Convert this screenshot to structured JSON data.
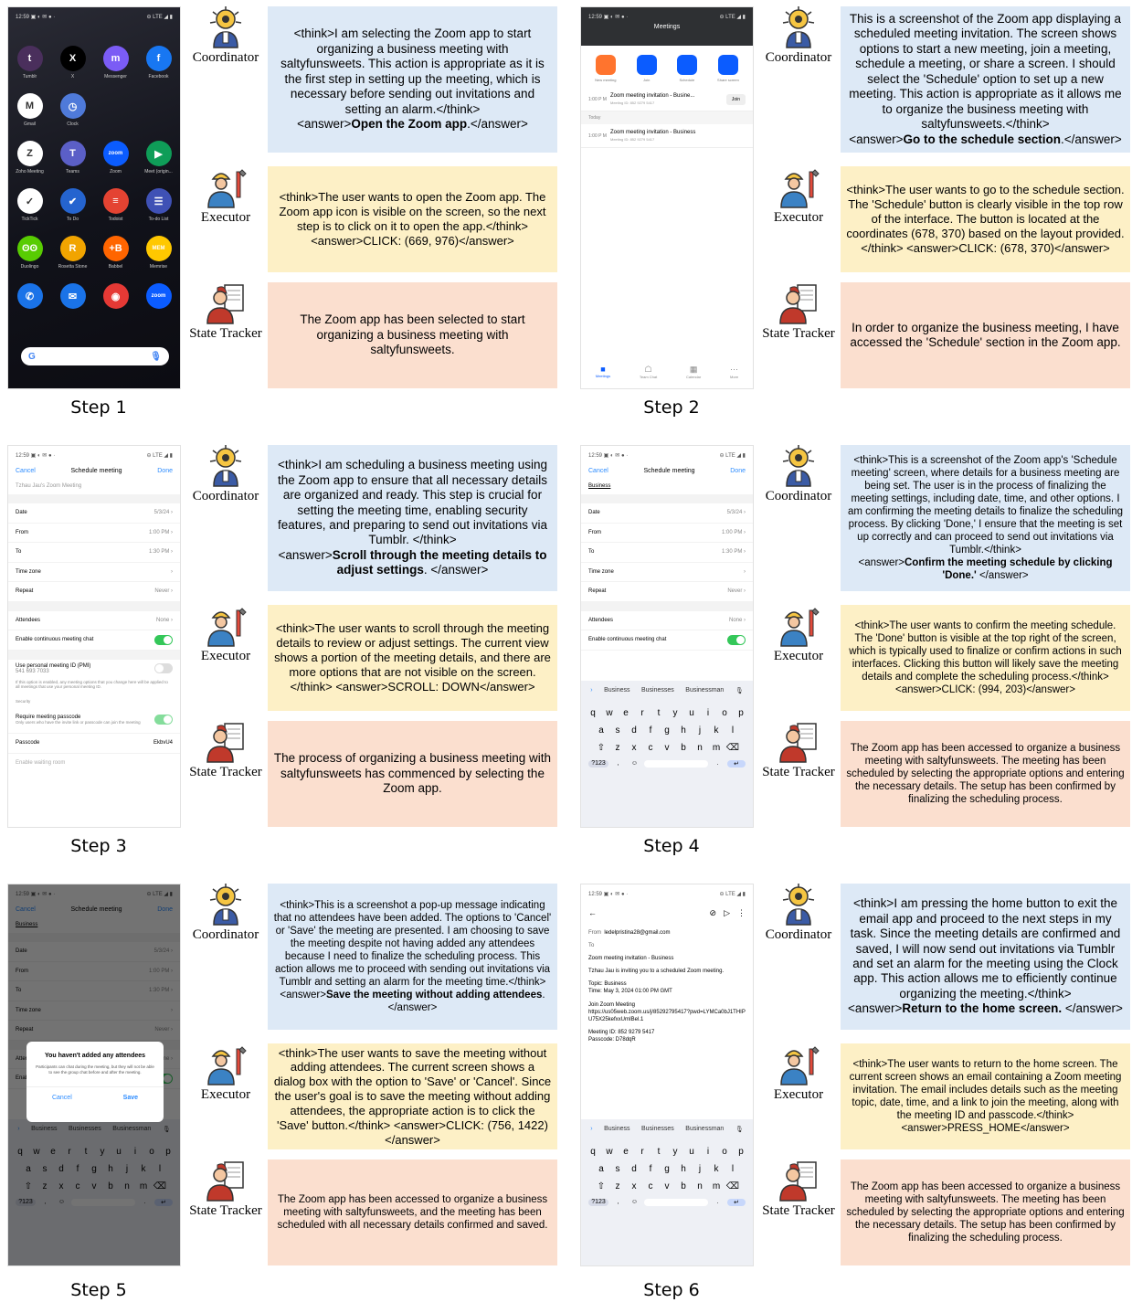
{
  "roles": {
    "coordinator": "Coordinator",
    "executor": "Executor",
    "tracker": "State Tracker"
  },
  "steps": [
    {
      "label": "Step 1",
      "coord": {
        "think": "<think>I am selecting the Zoom app to start organizing a business meeting with saltyfunsweets. This action is appropriate as it is the first step in setting up the meeting, which is necessary before sending out invitations and setting an alarm.</think>",
        "pre": "<answer>",
        "bold": "Open the Zoom app",
        "post": ".</answer>"
      },
      "exec": "<think>The user wants to open the Zoom app. The Zoom app icon is visible on the screen, so the next step is to click on it to open the app.</think> <answer>CLICK: (669, 976)</answer>",
      "tracker": "The Zoom app has been selected to start organizing a business meeting with saltyfunsweets."
    },
    {
      "label": "Step 2",
      "coord": {
        "think": "This is a screenshot of the Zoom app displaying a scheduled meeting invitation. The screen shows options to start a new meeting, join a meeting, schedule a meeting, or share a screen. I should select the 'Schedule' option to set up a new meeting. This action is appropriate as it allows me to organize the business meeting with saltyfunsweets.</think>",
        "pre": "<answer>",
        "bold": "Go to the schedule section",
        "post": ".</answer>"
      },
      "exec": "<think>The user wants to go to the schedule section. The 'Schedule' button is clearly visible in the top row of the interface. The button is located at the coordinates (678, 370) based on the layout provided.</think> <answer>CLICK: (678, 370)</answer>",
      "tracker": "In order to organize the business meeting, I have accessed the 'Schedule' section in the Zoom app."
    },
    {
      "label": "Step 3",
      "coord": {
        "think": "<think>I am scheduling a business meeting using the Zoom app to ensure that all necessary details are organized and ready. This step is crucial for setting the meeting time, enabling security features, and preparing to send out invitations via Tumblr. </think>",
        "pre": "<answer>",
        "bold": "Scroll through the meeting details to adjust settings",
        "post": ". </answer>"
      },
      "exec": "<think>The user wants to scroll through the meeting details to review or adjust settings. The current view shows a portion of the meeting details, and there are more options that are not visible on the screen.</think> <answer>SCROLL: DOWN</answer>",
      "tracker": "The process of organizing a business meeting with saltyfunsweets has commenced by selecting the Zoom app."
    },
    {
      "label": "Step 4",
      "coord": {
        "think": "<think>This is a screenshot of the Zoom app's 'Schedule meeting' screen, where details for a business meeting are being set. The user is in the process of finalizing the meeting settings, including date, time, and other options. I am confirming the meeting details to finalize the scheduling process. By clicking 'Done,' I ensure that the meeting is set up correctly and can proceed to send out invitations via Tumblr.</think>",
        "pre": "<answer>",
        "bold": "Confirm the meeting schedule by clicking 'Done.'",
        "post": " </answer>"
      },
      "exec": "<think>The user wants to confirm the meeting schedule. The 'Done' button is visible at the top right of the screen, which is typically used to finalize or confirm actions in such interfaces. Clicking this button will likely save the meeting details and complete the scheduling process.</think> <answer>CLICK: (994, 203)</answer>",
      "tracker": "The Zoom app has been accessed to organize a business meeting with saltyfunsweets. The meeting has been scheduled by selecting the appropriate options and entering the necessary details. The setup has been confirmed by finalizing the scheduling process."
    },
    {
      "label": "Step 5",
      "coord": {
        "think": "<think>This is a screenshot a pop-up message indicating that no attendees have been added. The options to 'Cancel' or 'Save' the meeting are presented. I am choosing to save the meeting despite not having added any attendees because I need to finalize the scheduling process. This action allows me to proceed with sending out invitations via Tumblr and setting an alarm for the meeting time.</think>",
        "pre": "<answer>",
        "bold": "Save the meeting without adding attendees",
        "post": ". </answer>"
      },
      "exec": "<think>The user wants to save the meeting without adding attendees. The current screen shows a dialog box with the option to 'Save' or 'Cancel'. Since the user's goal is to save the meeting without adding attendees, the appropriate action is to click the 'Save' button.</think> <answer>CLICK: (756, 1422)</answer>",
      "tracker": "The Zoom app has been accessed to organize a business meeting with saltyfunsweets, and the meeting has been scheduled with all necessary details confirmed and saved."
    },
    {
      "label": "Step 6",
      "coord": {
        "think": "<think>I am pressing the home button to exit the email app and proceed to the next steps in my task. Since the meeting details are confirmed and saved, I will now send out invitations via Tumblr and set an alarm for the meeting using the Clock app. This action allows me to efficiently continue organizing the meeting.</think>",
        "pre": "<answer>",
        "bold": "Return to the home screen.",
        "post": " </answer>"
      },
      "exec": "<think>The user wants to return to the home screen. The current screen shows an email containing a Zoom meeting invitation. The email includes details such as the meeting topic, date, time, and a link to join the meeting, along with the meeting ID and passcode.</think> <answer>PRESS_HOME</answer>",
      "tracker": "The Zoom app has been accessed to organize a business meeting with saltyfunsweets. The meeting has been scheduled by selecting the appropriate options and entering the necessary details. The setup has been confirmed by finalizing the scheduling process."
    }
  ],
  "phone": {
    "time": "12:59",
    "signal": "LTE",
    "home_apps": [
      {
        "name": "Tumblr",
        "color": "#4a2f5c",
        "glyph": "t"
      },
      {
        "name": "X",
        "color": "#000000",
        "glyph": "X"
      },
      {
        "name": "Messenger",
        "color": "#7b5cf5",
        "glyph": "m"
      },
      {
        "name": "Facebook",
        "color": "#1877f2",
        "glyph": "f"
      },
      {
        "name": "Gmail",
        "color": "#ffffff",
        "glyph": "M"
      },
      {
        "name": "Clock",
        "color": "#4f7ad9",
        "glyph": "◷"
      },
      {
        "name": "",
        "color": "transparent",
        "glyph": ""
      },
      {
        "name": "",
        "color": "transparent",
        "glyph": ""
      },
      {
        "name": "Zoho Meeting",
        "color": "#ffffff",
        "glyph": "Z"
      },
      {
        "name": "Teams",
        "color": "#5b5fc7",
        "glyph": "T"
      },
      {
        "name": "Zoom",
        "color": "#0b5cff",
        "glyph": "zoom"
      },
      {
        "name": "Meet (origin...",
        "color": "#0f9d58",
        "glyph": "▶"
      },
      {
        "name": "TickTick",
        "color": "#ffffff",
        "glyph": "✓"
      },
      {
        "name": "To Do",
        "color": "#2564cf",
        "glyph": "✔"
      },
      {
        "name": "Todoist",
        "color": "#e44332",
        "glyph": "≡"
      },
      {
        "name": "To-do List",
        "color": "#3f51b5",
        "glyph": "☰"
      },
      {
        "name": "Duolingo",
        "color": "#58cc02",
        "glyph": "ʘʘ"
      },
      {
        "name": "Rosetta Stone",
        "color": "#f1a400",
        "glyph": "R"
      },
      {
        "name": "Babbel",
        "color": "#ff6500",
        "glyph": "+B"
      },
      {
        "name": "Memrise",
        "color": "#ffc800",
        "glyph": "MEM"
      },
      {
        "name": "",
        "color": "#1a73e8",
        "glyph": "✆"
      },
      {
        "name": "",
        "color": "#1a73e8",
        "glyph": "✉"
      },
      {
        "name": "",
        "color": "#e53935",
        "glyph": "◉"
      },
      {
        "name": "",
        "color": "#0b5cff",
        "glyph": "zoom"
      }
    ],
    "search_glyph": "G",
    "meetings": {
      "title": "Meetings",
      "actions": [
        "New meeting",
        "Join",
        "Schedule",
        "Share screen"
      ],
      "row1": {
        "time": "1:00 P M",
        "title": "Zoom meeting invitation - Busine...",
        "sub": "Meeting ID: 852 9279 5417",
        "btn": "Join"
      },
      "today": "Today",
      "row2": {
        "time": "1:00 P M",
        "title": "Zoom meeting invitation - Business",
        "sub": "Meeting ID: 852 9279 5417"
      },
      "tabs": [
        "Meetings",
        "Team Chat",
        "Calendar",
        "More"
      ]
    },
    "schedule": {
      "cancel": "Cancel",
      "title": "Schedule meeting",
      "done": "Done",
      "topic": "Tzhau Jau's Zoom Meeting",
      "topic_typed": "Business",
      "date_label": "Date",
      "date": "5/3/24",
      "from_label": "From",
      "from": "1:00 PM",
      "to_label": "To",
      "to": "1:30 PM",
      "tz": "Time zone",
      "repeat_label": "Repeat",
      "repeat": "Never",
      "att_label": "Attendees",
      "att": "None",
      "chat": "Enable continuous meeting chat",
      "pmi": "Use personal meeting ID (PMI)",
      "pmi_num": "541 693 7033",
      "pmi_note": "If this option is enabled, any meeting options that you change here will be applied to all meetings that use your personal meeting ID.",
      "security": "Security",
      "passreq": "Require meeting passcode",
      "passnote": "Only users who have the invite link or passcode can join the meeting",
      "passcode_label": "Passcode",
      "passcode": "EkbvU4",
      "waiting": "Enable waiting room"
    },
    "keyboard": {
      "sugg": [
        "Business",
        "Businesses",
        "Businessman"
      ],
      "row1": "qwertyuiop",
      "row2": "asdfghjkl",
      "row3": "zxcvbnm",
      "sym": "?123"
    },
    "dialog": {
      "title": "You haven't added any attendees",
      "body": "Participants can chat during the meeting, but they will not be able to see the group chat before and after the meeting.",
      "cancel": "Cancel",
      "save": "Save"
    },
    "mail": {
      "from_label": "From",
      "from": "ledelpristina28@gmail.com",
      "to_label": "To",
      "subject": "Zoom meeting invitation - Business",
      "l1": "Tzhau Jau is inviting you to a scheduled Zoom meeting.",
      "l2": "Topic: Business",
      "l3": "Time: May 3, 2024 01:00 PM GMT",
      "l4": "Join Zoom Meeting",
      "l5": "https://us05web.zoom.us/j/85292795417?pwd=LYMCa0bJ1THIPU75X25kefxxUmIBel.1",
      "l6": "Meeting ID: 852 9279 5417",
      "l7": "Passcode: D78dqR"
    }
  }
}
